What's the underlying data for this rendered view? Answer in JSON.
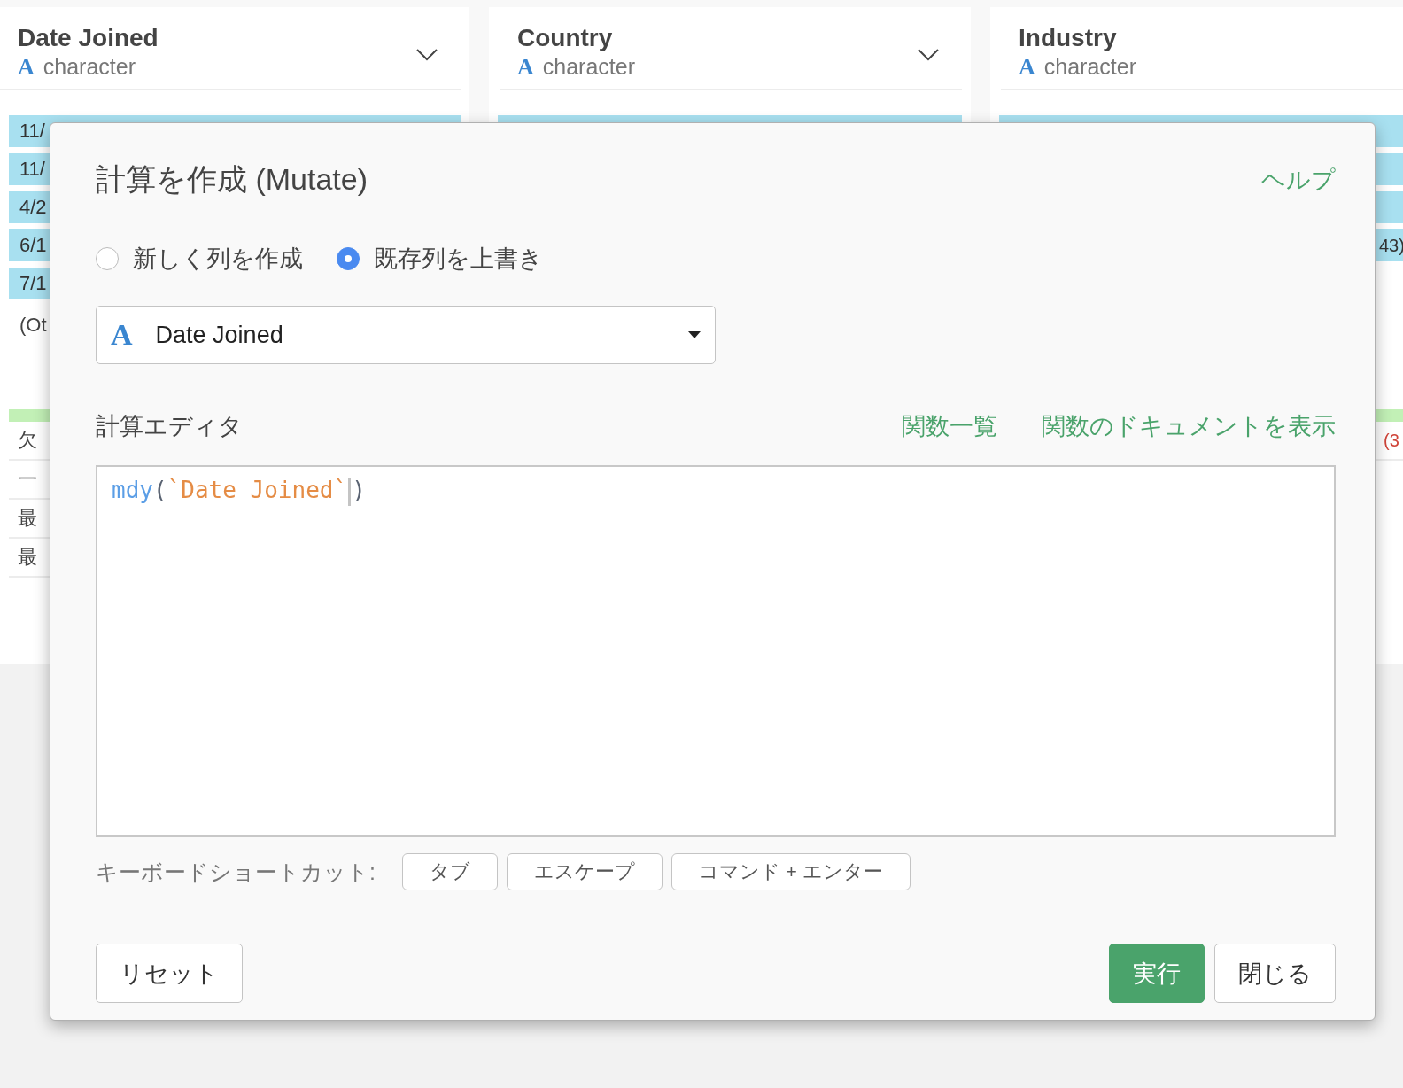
{
  "columns": [
    {
      "name": "Date Joined",
      "type_icon": "A",
      "type_label": "character",
      "menu": true,
      "bars": [
        {
          "label": "11/",
          "kind": "bar"
        },
        {
          "label": "11/",
          "kind": "bar"
        },
        {
          "label": "4/2",
          "kind": "bar"
        },
        {
          "label": "6/1",
          "kind": "bar"
        },
        {
          "label": "7/1",
          "kind": "bar"
        }
      ],
      "other": "(Ot",
      "stats": [
        {
          "label": "欠"
        },
        {
          "label": "一"
        },
        {
          "label": "最"
        },
        {
          "label": "最"
        }
      ]
    },
    {
      "name": "Country",
      "type_icon": "A",
      "type_label": "character",
      "menu": true,
      "bars": [
        {
          "kind": "bar"
        }
      ]
    },
    {
      "name": "Industry",
      "type_icon": "A",
      "type_label": "character",
      "bars": [
        {
          "kind": "bar"
        },
        {
          "kind": "bar"
        },
        {
          "kind": "bar"
        },
        {
          "label": "43)",
          "kind": "bar"
        }
      ],
      "stats": [
        {
          "label": "(3",
          "alert": true
        }
      ]
    }
  ],
  "dialog": {
    "title": "計算を作成 (Mutate)",
    "help_link": "ヘルプ",
    "options": [
      {
        "label": "新しく列を作成",
        "selected": false
      },
      {
        "label": "既存列を上書き",
        "selected": true
      }
    ],
    "column_select": {
      "type_icon": "A",
      "value": "Date Joined"
    },
    "editor": {
      "label": "計算エディタ",
      "links": [
        "関数一覧",
        "関数のドキュメントを表示"
      ],
      "code": [
        {
          "text": "mdy",
          "kind": "function"
        },
        {
          "text": "(",
          "kind": "paren"
        },
        {
          "text": "`Date Joined`",
          "kind": "string"
        },
        {
          "text": ")",
          "kind": "paren",
          "cursor_before": true
        }
      ]
    },
    "shortcuts": {
      "label": "キーボードショートカット:",
      "keys": [
        "タブ",
        "エスケープ",
        "コマンド + エンター"
      ]
    },
    "buttons": [
      {
        "label": "リセット",
        "kind": "secondary"
      },
      {
        "label": "実行",
        "kind": "primary"
      },
      {
        "label": "閉じる",
        "kind": "secondary"
      }
    ]
  }
}
